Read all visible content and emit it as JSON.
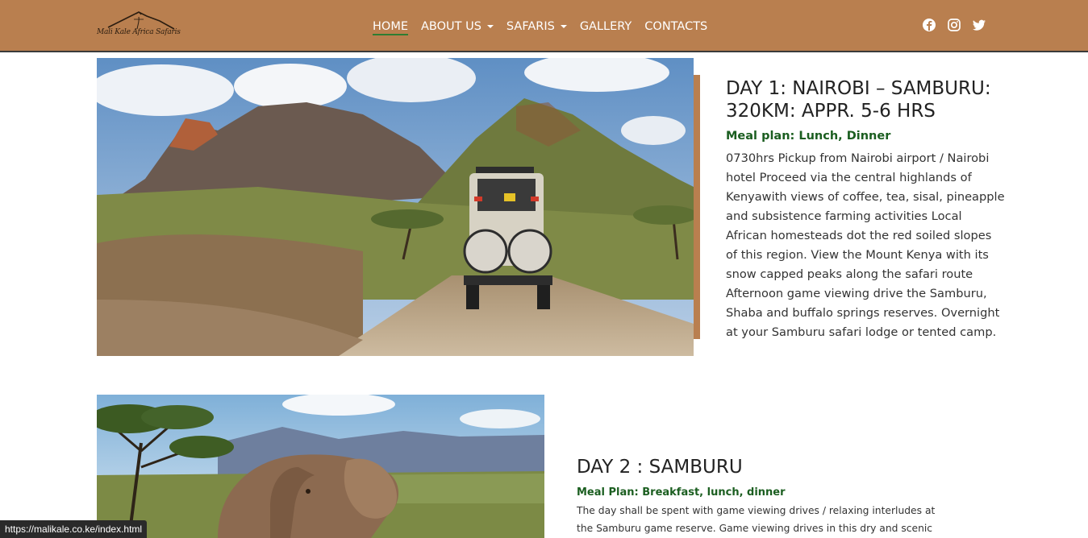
{
  "header": {
    "logo_text": "Mali Kale Africa Safaris",
    "nav": [
      {
        "label": "HOME",
        "active": true,
        "dropdown": false
      },
      {
        "label": "ABOUT US",
        "active": false,
        "dropdown": true
      },
      {
        "label": "SAFARIS",
        "active": false,
        "dropdown": true
      },
      {
        "label": "GALLERY",
        "active": false,
        "dropdown": false
      },
      {
        "label": "CONTACTS",
        "active": false,
        "dropdown": false
      }
    ],
    "social_icons": [
      "facebook-icon",
      "instagram-icon",
      "twitter-icon"
    ]
  },
  "colors": {
    "header_bg": "#b97f4f",
    "meal_text": "#1b5e20",
    "active_underline": "#2e7d32"
  },
  "days": [
    {
      "title_line1": "DAY 1: NAIROBI – SAMBURU:",
      "title_line2": "320KM: APPR. 5-6 HRS",
      "meal": "Meal plan: Lunch, Dinner",
      "lines": [
        "0730hrs Pickup from Nairobi airport / Nairobi",
        "hotel Proceed via the central highlands of",
        "Kenyawith views of coffee, tea, sisal, pineapple",
        "and subsistence farming activities Local",
        "African homesteads dot the red soiled slopes",
        "of this region. View the Mount Kenya with its",
        "snow capped peaks along the safari route",
        "Afternoon game viewing drive the Samburu,",
        "Shaba and buffalo springs reserves. Overnight",
        "at your Samburu safari lodge or tented camp."
      ],
      "image": "safari-vehicle-samburu-photo"
    },
    {
      "title": "DAY 2 : SAMBURU",
      "meal": "Meal Plan: Breakfast, lunch, dinner",
      "lines": [
        "The day shall be spent with game viewing drives / relaxing interludes at",
        "the Samburu game reserve. Game viewing drives in this dry and scenic"
      ],
      "image": "elephant-samburu-photo"
    }
  ],
  "status_bar": {
    "url": "https://malikale.co.ke/index.html"
  }
}
